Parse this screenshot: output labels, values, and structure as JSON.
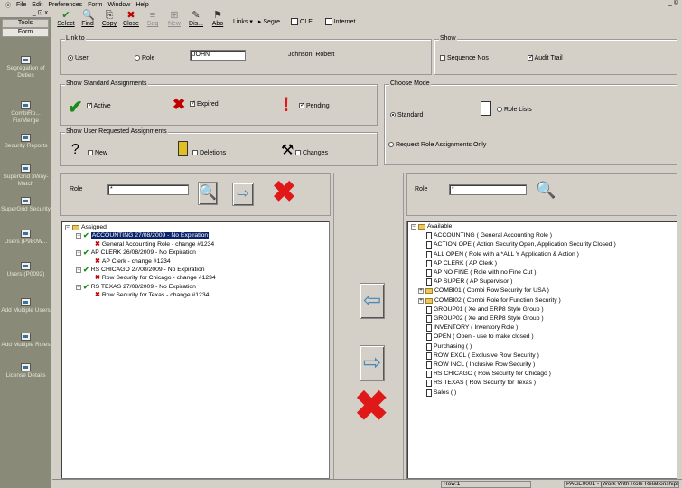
{
  "menubar": {
    "items": [
      "File",
      "Edit",
      "Preferences",
      "Form",
      "Window",
      "Help"
    ],
    "window_control": "_ ©"
  },
  "sidebar": {
    "pin": "_ ⊡ x",
    "tools_label": "Tools",
    "form_label": "Form",
    "items": [
      {
        "label": "Segregation of Duties"
      },
      {
        "label": "CombiRo... Fix/Merge"
      },
      {
        "label": "Security Reports"
      },
      {
        "label": "SuperGrid 3Way-Match"
      },
      {
        "label": "SuperGrid Security"
      },
      {
        "label": "Users (P980W..."
      },
      {
        "label": "Users (P0092)"
      },
      {
        "label": "Add Multiple Users"
      },
      {
        "label": "Add Multiple Roles"
      },
      {
        "label": "License Details"
      }
    ]
  },
  "toolbar": {
    "buttons": [
      {
        "label": "Select",
        "icon": "✔",
        "color": "#1a8a1a",
        "disabled": false
      },
      {
        "label": "Find",
        "icon": "🔍",
        "color": "#333333",
        "disabled": false
      },
      {
        "label": "Copy",
        "icon": "⎘",
        "color": "#333333",
        "disabled": false
      },
      {
        "label": "Close",
        "icon": "✖",
        "color": "#c00000",
        "disabled": false
      },
      {
        "label": "Seq",
        "icon": "≡",
        "color": "#8a8a8a",
        "disabled": true
      },
      {
        "label": "New",
        "icon": "⊞",
        "color": "#8a8a8a",
        "disabled": true
      },
      {
        "label": "Dis...",
        "icon": "✎",
        "color": "#333333",
        "disabled": false
      },
      {
        "label": "Abo",
        "icon": "⚑",
        "color": "#333333",
        "disabled": false
      }
    ],
    "links_label": "Links",
    "segre_label": "Segre...",
    "ole_label": "OLE ...",
    "internet_label": "Internet"
  },
  "link_to": {
    "legend": "Link to",
    "user_label": "User",
    "role_label": "Role",
    "user_value": "JOHN",
    "user_name": "Johnson, Robert"
  },
  "show": {
    "legend": "Show",
    "sequence_label": "Sequence Nos",
    "audit_label": "Audit Trail"
  },
  "standard_assignments": {
    "legend": "Show Standard Assignments",
    "active_label": "Active",
    "expired_label": "Expired",
    "pending_label": "Pending"
  },
  "user_requested": {
    "legend": "Show User Requested Assignments",
    "new_label": "New",
    "deletions_label": "Deletions",
    "changes_label": "Changes"
  },
  "choose_mode": {
    "legend": "Choose Mode",
    "standard_label": "Standard",
    "role_lists_label": "Role Lists",
    "request_label": "Request Role Assignments Only"
  },
  "left_panel": {
    "role_label": "Role",
    "role_value": "*",
    "tree": [
      {
        "level": 0,
        "expander": "−",
        "icon": "folder",
        "text": "Assigned",
        "selected": false
      },
      {
        "level": 1,
        "expander": "−",
        "icon": "check",
        "text": "ACCOUNTING   27/08/2009 - No Expiration",
        "selected": true
      },
      {
        "level": 2,
        "expander": "",
        "icon": "x",
        "text": "General Accounting Role - change #1234",
        "selected": false
      },
      {
        "level": 1,
        "expander": "−",
        "icon": "check",
        "text": "AP CLERK   26/08/2009 - No Expiration",
        "selected": false
      },
      {
        "level": 2,
        "expander": "",
        "icon": "x",
        "text": "AP Clerk - change #1234",
        "selected": false
      },
      {
        "level": 1,
        "expander": "−",
        "icon": "check",
        "text": "RS CHICAGO   27/08/2009 - No Expiration",
        "selected": false
      },
      {
        "level": 2,
        "expander": "",
        "icon": "x",
        "text": "Row Security for Chicago - change #1234",
        "selected": false
      },
      {
        "level": 1,
        "expander": "−",
        "icon": "check",
        "text": "RS TEXAS   27/08/2009 - No Expiration",
        "selected": false
      },
      {
        "level": 2,
        "expander": "",
        "icon": "x",
        "text": "Row Security for Texas - change #1234",
        "selected": false
      }
    ]
  },
  "right_panel": {
    "role_label": "Role",
    "role_value": "*",
    "tree": [
      {
        "level": 0,
        "expander": "−",
        "icon": "folder",
        "text": "Available"
      },
      {
        "level": 1,
        "expander": "",
        "icon": "doc",
        "text": "ACCOUNTING ( General Accounting Role )"
      },
      {
        "level": 1,
        "expander": "",
        "icon": "doc",
        "text": "ACTION OPE ( Action Security Open, Application Security Closed )"
      },
      {
        "level": 1,
        "expander": "",
        "icon": "doc",
        "text": "ALL OPEN ( Role with a *ALL Y Application & Action )"
      },
      {
        "level": 1,
        "expander": "",
        "icon": "doc",
        "text": "AP CLERK ( AP Clerk )"
      },
      {
        "level": 1,
        "expander": "",
        "icon": "doc",
        "text": "AP NO FINE ( Role with no Fine Cut )"
      },
      {
        "level": 1,
        "expander": "",
        "icon": "doc",
        "text": "AP SUPER ( AP Supervisor )"
      },
      {
        "level": 1,
        "expander": "+",
        "icon": "folder",
        "text": "COMBI01 ( Combi Row Security for USA )"
      },
      {
        "level": 1,
        "expander": "+",
        "icon": "folder",
        "text": "COMBI02 ( Combi Role for Function Security )"
      },
      {
        "level": 1,
        "expander": "",
        "icon": "doc",
        "text": "GROUP01 ( Xe and ERP8 Style Group )"
      },
      {
        "level": 1,
        "expander": "",
        "icon": "doc",
        "text": "GROUP02 ( Xe and ERP8 Style Group )"
      },
      {
        "level": 1,
        "expander": "",
        "icon": "doc",
        "text": "INVENTORY ( Inventory Role )"
      },
      {
        "level": 1,
        "expander": "",
        "icon": "doc",
        "text": "OPEN ( Open - use to make closed )"
      },
      {
        "level": 1,
        "expander": "",
        "icon": "doc",
        "text": "Purchasing ( )"
      },
      {
        "level": 1,
        "expander": "",
        "icon": "doc",
        "text": "ROW EXCL ( Exclusive Row Security )"
      },
      {
        "level": 1,
        "expander": "",
        "icon": "doc",
        "text": "ROW INCL ( Inclusive Row Security )"
      },
      {
        "level": 1,
        "expander": "",
        "icon": "doc",
        "text": "RS CHICAGO ( Row Security for Chicago )"
      },
      {
        "level": 1,
        "expander": "",
        "icon": "doc",
        "text": "RS TEXAS ( Row Security for Texas )"
      },
      {
        "level": 1,
        "expander": "",
        "icon": "doc",
        "text": "Sales ( )"
      }
    ]
  },
  "statusbar": {
    "row_text": "Row:1",
    "form_text": "PAGE0001 - [Work With Role Relationships]"
  },
  "colors": {
    "accent_selection": "#0a246a",
    "active_check": "#1a8a1a",
    "expired_x": "#c00000",
    "arrow_blue": "#4488bb"
  }
}
